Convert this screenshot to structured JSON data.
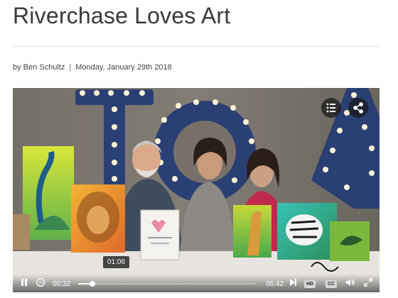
{
  "article": {
    "title": "Riverchase Loves Art",
    "author": "by Ben Schultz",
    "separator": "|",
    "date": "Monday, January 29th 2018"
  },
  "video": {
    "current_time": "00:32",
    "duration": "06:42",
    "hover_time": "01:06",
    "progress_fraction": 0.079,
    "hover_fraction": 0.164,
    "replay_seconds": "10",
    "hd_label": "HD",
    "cc_label": "CC",
    "icons": {
      "pause": "pause-icon",
      "replay": "replay-10-icon",
      "next": "next-icon",
      "volume": "volume-icon",
      "fullscreen": "fullscreen-icon",
      "chapters": "chapters-list-icon",
      "share": "share-icon"
    }
  }
}
